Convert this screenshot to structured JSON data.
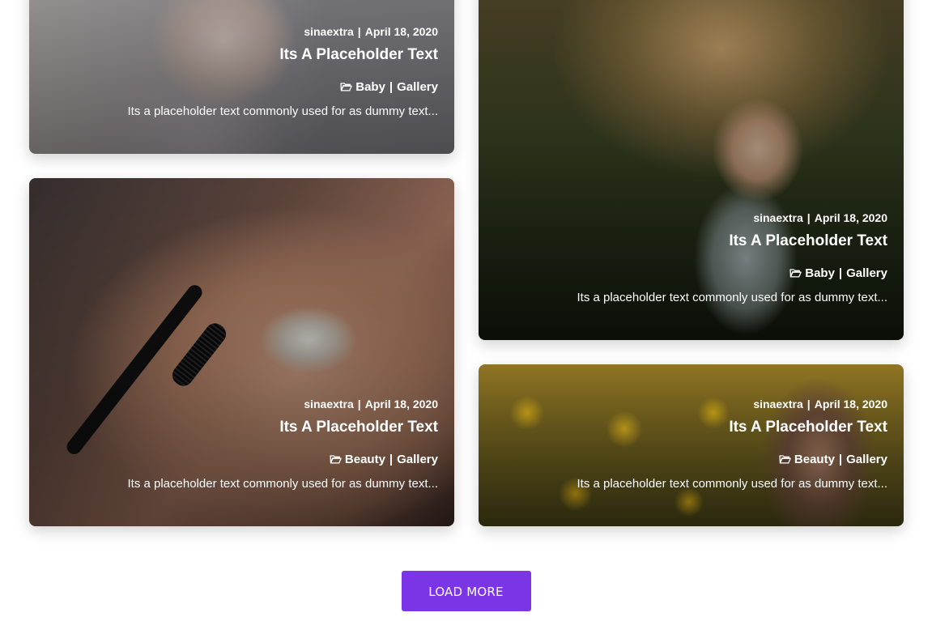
{
  "cards": [
    {
      "author": "sinaextra",
      "date": "April 18, 2020",
      "title": "Its A Placeholder Text",
      "category": "Baby",
      "tag": "Gallery",
      "excerpt": "Its a placeholder text commonly used for as dummy text..."
    },
    {
      "author": "sinaextra",
      "date": "April 18, 2020",
      "title": "Its A Placeholder Text",
      "category": "Baby",
      "tag": "Gallery",
      "excerpt": "Its a placeholder text commonly used for as dummy text..."
    },
    {
      "author": "sinaextra",
      "date": "April 18, 2020",
      "title": "Its A Placeholder Text",
      "category": "Beauty",
      "tag": "Gallery",
      "excerpt": "Its a placeholder text commonly used for as dummy text..."
    },
    {
      "author": "sinaextra",
      "date": "April 18, 2020",
      "title": "Its A Placeholder Text",
      "category": "Beauty",
      "tag": "Gallery",
      "excerpt": "Its a placeholder text commonly used for as dummy text..."
    }
  ],
  "separator": "|",
  "load_more_label": "LOAD MORE",
  "icons": {
    "category": "folder-open-icon"
  },
  "colors": {
    "accent": "#7b35e7",
    "text_on_image": "#ffffff"
  }
}
